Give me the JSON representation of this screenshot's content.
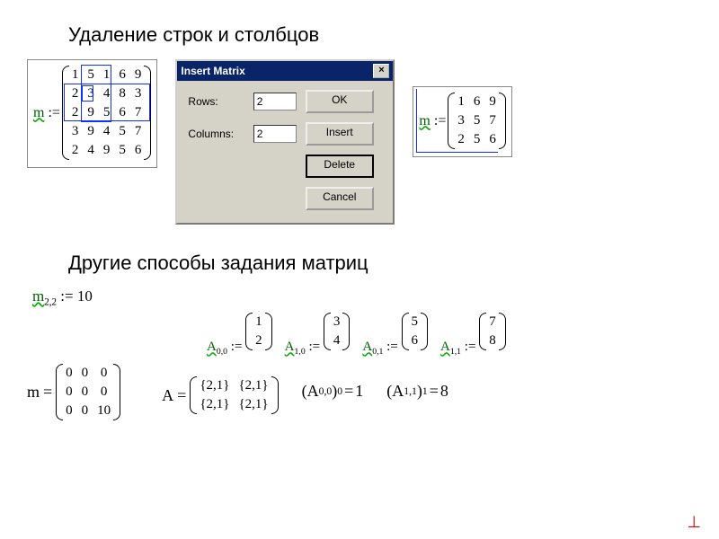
{
  "heading1": "Удаление строк и столбцов",
  "heading2": "Другие способы задания матриц",
  "leftMatrix": {
    "label": "m",
    "op": ":=",
    "rows": [
      [
        "1",
        "5",
        "1",
        "6",
        "9"
      ],
      [
        "2",
        "3",
        "4",
        "8",
        "3"
      ],
      [
        "2",
        "9",
        "5",
        "6",
        "7"
      ],
      [
        "3",
        "9",
        "4",
        "5",
        "7"
      ],
      [
        "2",
        "4",
        "9",
        "5",
        "6"
      ]
    ]
  },
  "dialog": {
    "title": "Insert Matrix",
    "rowsLabel": "Rows:",
    "rowsValue": "2",
    "colsLabel": "Columns:",
    "colsValue": "2",
    "btnOk": "OK",
    "btnInsert": "Insert",
    "btnDelete": "Delete",
    "btnCancel": "Cancel"
  },
  "rightMatrix": {
    "label": "m",
    "op": ":=",
    "rows": [
      [
        "1",
        "6",
        "9"
      ],
      [
        "3",
        "5",
        "7"
      ],
      [
        "2",
        "5",
        "6"
      ]
    ]
  },
  "scalarAssign": {
    "var": "m",
    "sub": "2,2",
    "op": ":=",
    "val": "10"
  },
  "aAssigns": [
    {
      "var": "A",
      "sub": "0,0",
      "op": ":=",
      "vec": [
        "1",
        "2"
      ]
    },
    {
      "var": "A",
      "sub": "1,0",
      "op": ":=",
      "vec": [
        "3",
        "4"
      ]
    },
    {
      "var": "A",
      "sub": "0,1",
      "op": ":=",
      "vec": [
        "5",
        "6"
      ]
    },
    {
      "var": "A",
      "sub": "1,1",
      "op": ":=",
      "vec": [
        "7",
        "8"
      ]
    }
  ],
  "mEval": {
    "var": "m",
    "op": "=",
    "rows": [
      [
        "0",
        "0",
        "0"
      ],
      [
        "0",
        "0",
        "0"
      ],
      [
        "0",
        "0",
        "10"
      ]
    ]
  },
  "aEval": {
    "var": "A",
    "op": "=",
    "rows": [
      [
        "{2,1}",
        "{2,1}"
      ],
      [
        "{2,1}",
        "{2,1}"
      ]
    ]
  },
  "indexed": [
    {
      "expr": "(A",
      "sub1": "0,0",
      "mid": ")",
      "sub2": "0",
      "op": "=",
      "val": "1"
    },
    {
      "expr": "(A",
      "sub1": "1,1",
      "mid": ")",
      "sub2": "1",
      "op": "=",
      "val": "8"
    }
  ]
}
